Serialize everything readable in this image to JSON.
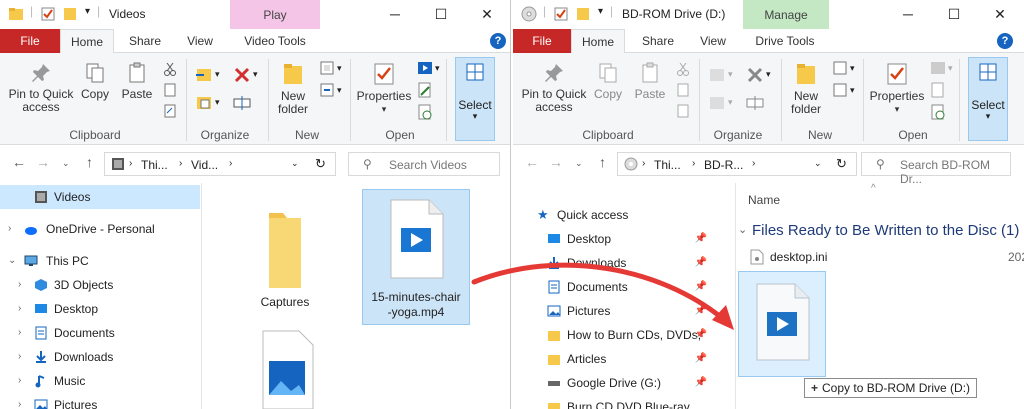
{
  "left": {
    "title": "Videos",
    "context_tab": "Play",
    "context_tab_bg": "#f4c5e6",
    "tabs": {
      "file": "File",
      "home": "Home",
      "share": "Share",
      "view": "View",
      "tools": "Video Tools"
    },
    "help": "?",
    "ribbon": {
      "pin": "Pin to Quick\naccess",
      "copy": "Copy",
      "paste": "Paste",
      "new_folder": "New\nfolder",
      "properties": "Properties",
      "select": "Select",
      "groups": {
        "clipboard": "Clipboard",
        "organize": "Organize",
        "new": "New",
        "open": "Open"
      }
    },
    "breadcrumb": [
      "Thi...",
      "Vid..."
    ],
    "search_placeholder": "Search Videos",
    "nav": [
      {
        "label": "Videos",
        "icon": "video-folder-icon",
        "selected": true
      },
      {
        "label": "OneDrive - Personal",
        "icon": "cloud-icon",
        "chev": "›"
      },
      {
        "label": "This PC",
        "icon": "pc-icon",
        "chev": "⌄"
      },
      {
        "label": "3D Objects",
        "icon": "cube-icon",
        "chev": "›"
      },
      {
        "label": "Desktop",
        "icon": "desktop-icon",
        "chev": "›"
      },
      {
        "label": "Documents",
        "icon": "documents-icon",
        "chev": "›"
      },
      {
        "label": "Downloads",
        "icon": "download-icon",
        "chev": "›"
      },
      {
        "label": "Music",
        "icon": "music-icon",
        "chev": "›"
      },
      {
        "label": "Pictures",
        "icon": "pictures-icon",
        "chev": "›"
      }
    ],
    "files": [
      {
        "name": "Captures",
        "icon": "folder-icon"
      },
      {
        "name": "15-minutes-chair\n-yoga.mp4",
        "icon": "video-file-icon",
        "selected": true
      },
      {
        "name": "",
        "icon": "image-file-icon"
      }
    ]
  },
  "right": {
    "title": "BD-ROM Drive (D:)",
    "context_tab": "Manage",
    "context_tab_bg": "#c4e7c4",
    "tabs": {
      "file": "File",
      "home": "Home",
      "share": "Share",
      "view": "View",
      "tools": "Drive Tools"
    },
    "help": "?",
    "ribbon": {
      "pin": "Pin to Quick\naccess",
      "copy": "Copy",
      "paste": "Paste",
      "new_folder": "New\nfolder",
      "properties": "Properties",
      "select": "Select",
      "groups": {
        "clipboard": "Clipboard",
        "organize": "Organize",
        "new": "New",
        "open": "Open"
      }
    },
    "breadcrumb": [
      "Thi...",
      "BD-R..."
    ],
    "search_placeholder": "Search BD-ROM Dr...",
    "nav": [
      {
        "label": "Quick access",
        "icon": "star-icon"
      },
      {
        "label": "Desktop",
        "icon": "desktop-icon",
        "pinned": true
      },
      {
        "label": "Downloads",
        "icon": "download-icon",
        "pinned": true
      },
      {
        "label": "Documents",
        "icon": "documents-icon",
        "pinned": true
      },
      {
        "label": "Pictures",
        "icon": "pictures-icon",
        "pinned": true
      },
      {
        "label": "How to Burn CDs, DVDs,",
        "icon": "folder-icon",
        "pinned": true
      },
      {
        "label": "Articles",
        "icon": "folder-icon",
        "pinned": true
      },
      {
        "label": "Google Drive (G:)",
        "icon": "drive-icon",
        "pinned": true
      },
      {
        "label": "Burn CD DVD Blue-ray",
        "icon": "folder-icon"
      }
    ],
    "column_name": "Name",
    "group_header": "Files Ready to Be Written to the Disc (1)",
    "file_row": {
      "name": "desktop.ini",
      "date": "202"
    },
    "drag_tooltip": "Copy to BD-ROM Drive (D:)",
    "drag_plus": "+"
  },
  "colors": {
    "file_tab": "#c62828",
    "accent": "#1565c0",
    "selection": "#cce8ff",
    "drag_arrow": "#e53935"
  }
}
